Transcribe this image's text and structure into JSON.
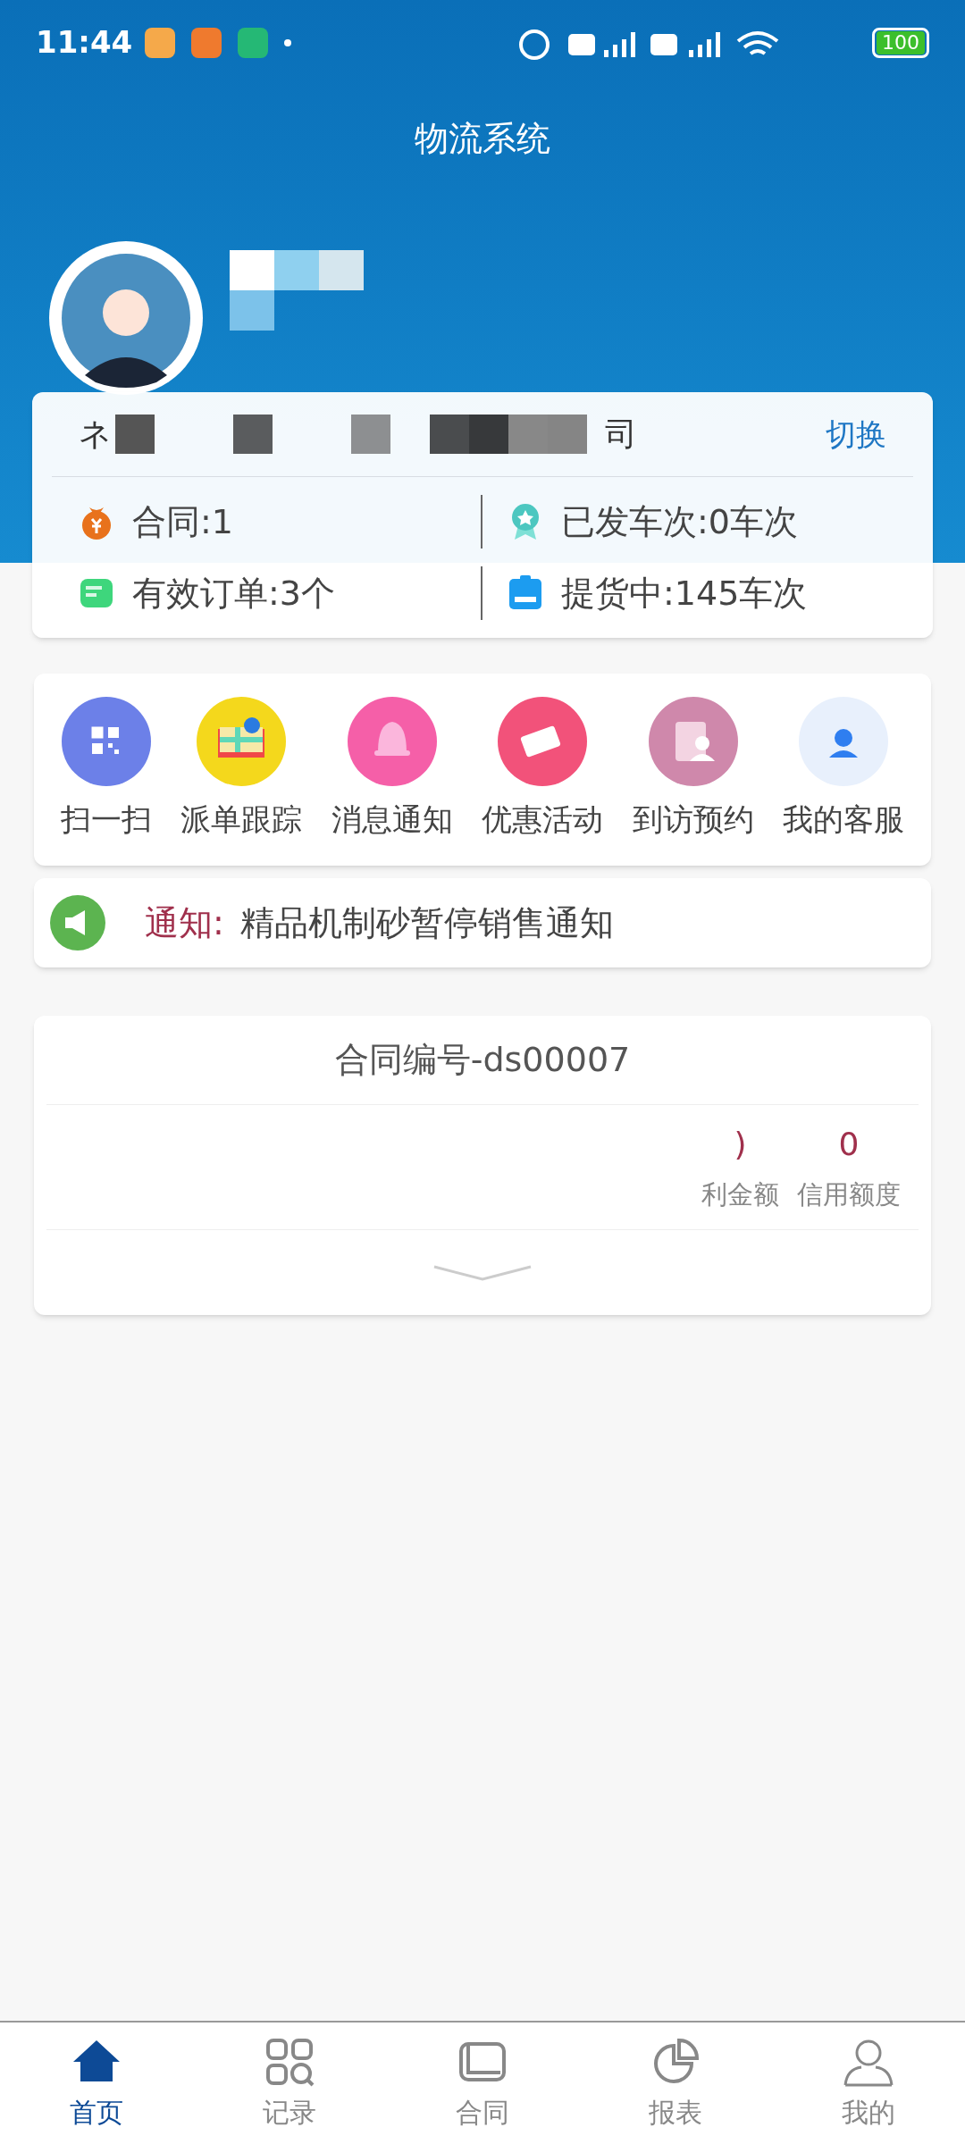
{
  "status_bar": {
    "time": "11:44",
    "battery": "100"
  },
  "header": {
    "title": "物流系统"
  },
  "profile": {
    "company_prefix": "ネ",
    "company_suffix": "司",
    "switch_label": "切换",
    "stats": [
      {
        "kind": "money",
        "text": "合同:1"
      },
      {
        "kind": "ribbon",
        "text": "已发车次:0车次"
      },
      {
        "kind": "order",
        "text": "有效订单:3个"
      },
      {
        "kind": "bag",
        "text": "提货中:145车次"
      }
    ]
  },
  "shortcuts": [
    {
      "kind": "qr",
      "label": "扫一扫"
    },
    {
      "kind": "map",
      "label": "派单跟踪"
    },
    {
      "kind": "bell",
      "label": "消息通知"
    },
    {
      "kind": "ticket",
      "label": "优惠活动"
    },
    {
      "kind": "visit",
      "label": "到访预约"
    },
    {
      "kind": "service",
      "label": "我的客服"
    }
  ],
  "notice": {
    "tag": "通知:",
    "text": "精品机制砂暂停销售通知"
  },
  "contract": {
    "title": "合同编号-ds00007",
    "columns": [
      {
        "value": ")",
        "label": "利金额"
      },
      {
        "value": "0",
        "label": "信用额度"
      }
    ]
  },
  "tab_bar": [
    {
      "kind": "home",
      "label": "首页",
      "selected": true
    },
    {
      "kind": "grid",
      "label": "记录",
      "selected": false
    },
    {
      "kind": "contract",
      "label": "合同",
      "selected": false
    },
    {
      "kind": "chart",
      "label": "报表",
      "selected": false
    },
    {
      "kind": "user",
      "label": "我的",
      "selected": false
    }
  ]
}
